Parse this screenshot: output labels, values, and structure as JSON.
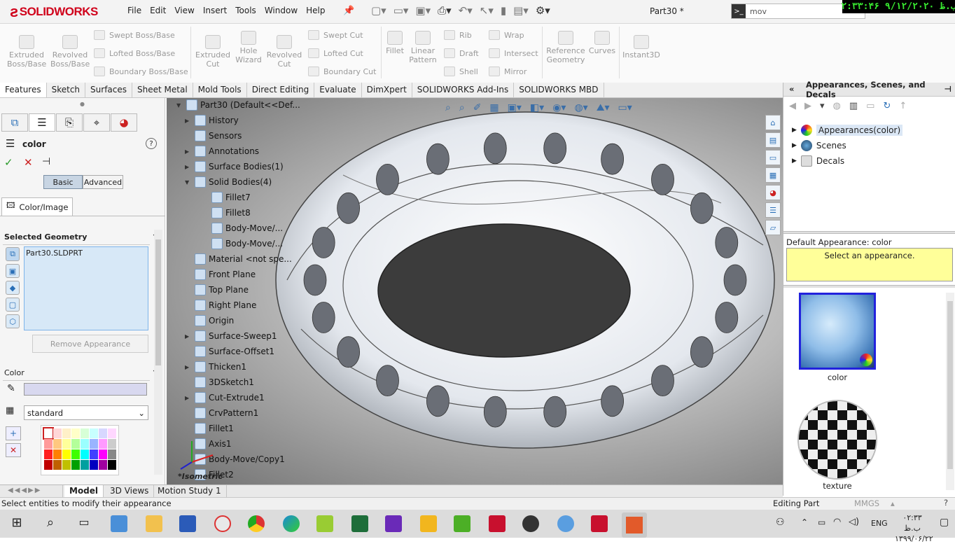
{
  "titlebar": {
    "brand": "SOLIDWORKS",
    "menu": [
      "File",
      "Edit",
      "View",
      "Insert",
      "Tools",
      "Window",
      "Help"
    ],
    "doc_title": "Part30 *",
    "search_value": "mov",
    "clock_overlay": "۲:۳۳:۴۶ ۹/۱۲/۲۰۲۰ ب.ظ"
  },
  "ribbon": {
    "large": [
      {
        "label": "Extruded\nBoss/Base"
      },
      {
        "label": "Revolved\nBoss/Base"
      },
      {
        "label": "Extruded\nCut"
      },
      {
        "label": "Hole\nWizard"
      },
      {
        "label": "Revolved\nCut"
      },
      {
        "label": "Fillet"
      },
      {
        "label": "Linear\nPattern"
      },
      {
        "label": "Reference\nGeometry"
      },
      {
        "label": "Curves"
      },
      {
        "label": "Instant3D"
      }
    ],
    "small": [
      "Swept Boss/Base",
      "Lofted Boss/Base",
      "Boundary Boss/Base",
      "Swept Cut",
      "Lofted Cut",
      "Boundary Cut",
      "Rib",
      "Draft",
      "Shell",
      "Wrap",
      "Intersect",
      "Mirror"
    ]
  },
  "command_tabs": [
    "Features",
    "Sketch",
    "Surfaces",
    "Sheet Metal",
    "Mold Tools",
    "Direct Editing",
    "Evaluate",
    "DimXpert",
    "SOLIDWORKS Add-Ins",
    "SOLIDWORKS MBD"
  ],
  "property_manager": {
    "title": "color",
    "mode_basic": "Basic",
    "mode_advanced": "Advanced",
    "subtab": "Color/Image",
    "selected_geometry_label": "Selected Geometry",
    "selected_item": "Part30.SLDPRT",
    "remove_button": "Remove Appearance",
    "color_label": "Color",
    "palette_select": "standard",
    "swatch_colors": [
      "#ffffff",
      "#ffd7d7",
      "#fff0c8",
      "#ffffc8",
      "#d7ffd7",
      "#c8ffff",
      "#d7d7ff",
      "#ffd7ff",
      "#ff9a9a",
      "#ffc880",
      "#ffff9a",
      "#b4ff9a",
      "#9affff",
      "#9ab4ff",
      "#ff9aff",
      "#cccccc",
      "#ff2020",
      "#ff8000",
      "#ffff00",
      "#40ff00",
      "#00ffff",
      "#4040ff",
      "#ff00ff",
      "#888888",
      "#c00000",
      "#c06000",
      "#c0c000",
      "#00a000",
      "#00a0a0",
      "#0000c0",
      "#a000a0",
      "#000000"
    ]
  },
  "feature_tree": [
    {
      "label": "Part30  (Default<<Def...",
      "arrow": "▼"
    },
    {
      "label": "History",
      "arrow": "▶"
    },
    {
      "label": "Sensors",
      "arrow": ""
    },
    {
      "label": "Annotations",
      "arrow": "▶"
    },
    {
      "label": "Surface Bodies(1)",
      "arrow": "▶"
    },
    {
      "label": "Solid Bodies(4)",
      "arrow": "▼"
    },
    {
      "label": "Fillet7",
      "arrow": "",
      "indent": 1
    },
    {
      "label": "Fillet8",
      "arrow": "",
      "indent": 1
    },
    {
      "label": "Body-Move/...",
      "arrow": "",
      "indent": 1
    },
    {
      "label": "Body-Move/...",
      "arrow": "",
      "indent": 1
    },
    {
      "label": "Material <not spe...",
      "arrow": ""
    },
    {
      "label": "Front Plane",
      "arrow": ""
    },
    {
      "label": "Top Plane",
      "arrow": ""
    },
    {
      "label": "Right Plane",
      "arrow": ""
    },
    {
      "label": "Origin",
      "arrow": ""
    },
    {
      "label": "Surface-Sweep1",
      "arrow": "▶"
    },
    {
      "label": "Surface-Offset1",
      "arrow": ""
    },
    {
      "label": "Thicken1",
      "arrow": "▶"
    },
    {
      "label": "3DSketch1",
      "arrow": ""
    },
    {
      "label": "Cut-Extrude1",
      "arrow": "▶"
    },
    {
      "label": "CrvPattern1",
      "arrow": ""
    },
    {
      "label": "Fillet1",
      "arrow": ""
    },
    {
      "label": "Axis1",
      "arrow": ""
    },
    {
      "label": "Body-Move/Copy1",
      "arrow": ""
    },
    {
      "label": "Fillet2",
      "arrow": ""
    }
  ],
  "viewport": {
    "view_label": "*Isometric"
  },
  "task_pane": {
    "title": "Appearances, Scenes, and Decals",
    "tree": [
      "Appearances(color)",
      "Scenes",
      "Decals"
    ],
    "default_label": "Default Appearance: color",
    "hint": "Select an appearance.",
    "thumbs": [
      "color",
      "texture"
    ]
  },
  "bottom_tabs": [
    "Model",
    "3D Views",
    "Motion Study 1"
  ],
  "status": {
    "left": "Select entities to modify their appearance",
    "mode": "Editing Part",
    "units": "MMGS"
  },
  "taskbar": {
    "lang": "ENG",
    "time": "۰۲:۳۳ ب.ظ",
    "date": "۱۳۹۹/۰۶/۲۲"
  }
}
